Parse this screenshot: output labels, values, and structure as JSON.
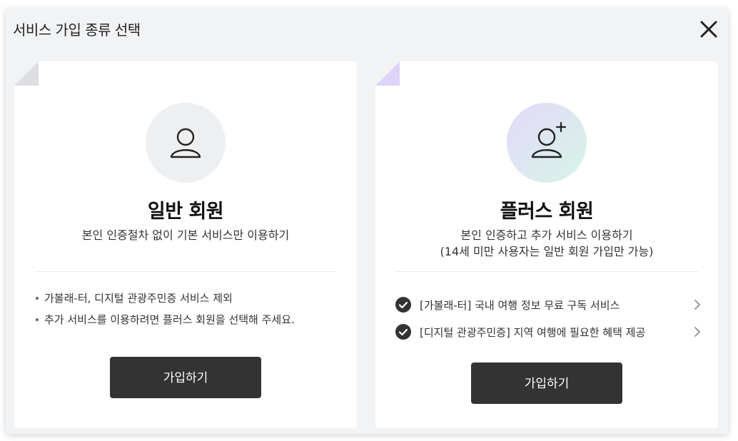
{
  "modal": {
    "title": "서비스 가입 종류 선택",
    "close_icon": "close-icon"
  },
  "basic": {
    "icon": "user-icon",
    "title": "일반 회원",
    "description": "본인 인증절차 없이 기본 서비스만 이용하기",
    "notes": [
      "가볼래-터, 디지털 관광주민증 서비스 제외",
      "추가 서비스를 이용하려면 플러스 회원을 선택해 주세요."
    ],
    "button_label": "가입하기"
  },
  "plus": {
    "icon": "user-plus-icon",
    "title": "플러스 회원",
    "description_line1": "본인 인증하고 추가 서비스 이용하기",
    "description_line2": "(14세 미만 사용자는 일반 회원 가입만 가능)",
    "features": [
      "[가볼래-터] 국내 여행 정보 무료 구독 서비스",
      "[디지털 관광주민증] 지역 여행에 필요한 혜택 제공"
    ],
    "button_label": "가입하기"
  },
  "colors": {
    "button_bg": "#333333",
    "modal_bg": "#f2f3f5",
    "plus_gradient_start": "#e4d8fb",
    "plus_gradient_end": "#d6f6e6"
  }
}
